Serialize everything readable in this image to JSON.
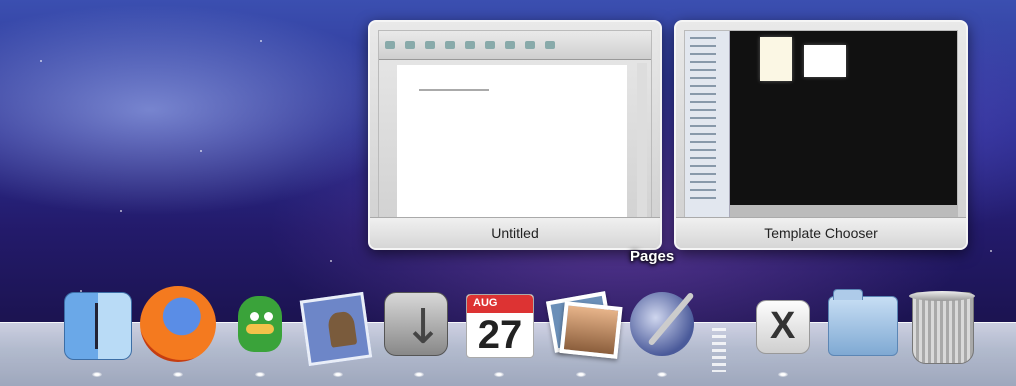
{
  "expose": {
    "app_name": "Pages",
    "windows": [
      {
        "title": "Untitled"
      },
      {
        "title": "Template Chooser"
      }
    ]
  },
  "dock": {
    "items": [
      {
        "name": "finder-icon"
      },
      {
        "name": "firefox-icon"
      },
      {
        "name": "adium-icon"
      },
      {
        "name": "mail-icon"
      },
      {
        "name": "time-machine-icon"
      },
      {
        "name": "ical-icon",
        "month": "AUG",
        "day": "27"
      },
      {
        "name": "iphoto-icon"
      },
      {
        "name": "pages-icon"
      },
      {
        "name": "x11-icon"
      },
      {
        "name": "documents-folder-icon"
      },
      {
        "name": "trash-icon"
      }
    ]
  }
}
